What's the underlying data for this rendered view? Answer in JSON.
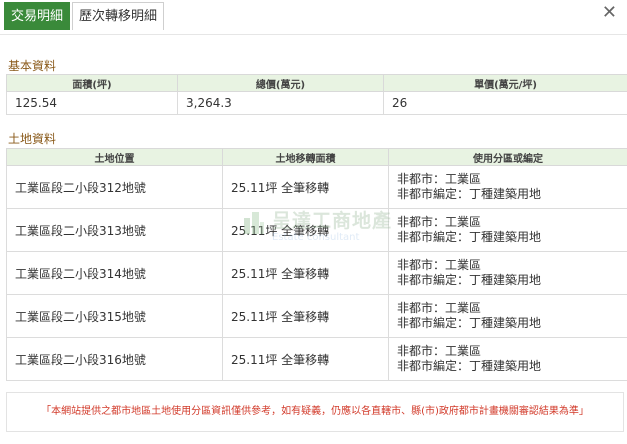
{
  "tabs": [
    {
      "label": "交易明細",
      "active": true
    },
    {
      "label": "歷次轉移明細",
      "active": false
    }
  ],
  "close_icon": "close-icon",
  "basic": {
    "title": "基本資料",
    "headers": [
      "面積(坪)",
      "總價(萬元)",
      "單價(萬元/坪)"
    ],
    "row": [
      "125.54",
      "3,264.3",
      "26"
    ]
  },
  "land": {
    "title": "土地資料",
    "headers": [
      "土地位置",
      "土地移轉面積",
      "使用分區或編定"
    ],
    "rows": [
      {
        "location": "工業區段二小段312地號",
        "area": "25.11坪 全筆移轉",
        "usage1": "非都市：工業區",
        "usage2": "非都市編定：丁種建築用地"
      },
      {
        "location": "工業區段二小段313地號",
        "area": "25.11坪 全筆移轉",
        "usage1": "非都市：工業區",
        "usage2": "非都市編定：丁種建築用地"
      },
      {
        "location": "工業區段二小段314地號",
        "area": "25.11坪 全筆移轉",
        "usage1": "非都市：工業區",
        "usage2": "非都市編定：丁種建築用地"
      },
      {
        "location": "工業區段二小段315地號",
        "area": "25.11坪 全筆移轉",
        "usage1": "非都市：工業區",
        "usage2": "非都市編定：丁種建築用地"
      },
      {
        "location": "工業區段二小段316地號",
        "area": "25.11坪 全筆移轉",
        "usage1": "非都市：工業區",
        "usage2": "非都市編定：丁種建築用地"
      }
    ]
  },
  "watermark": {
    "title": "呈達工商地產",
    "subtitle": "Estate consultant"
  },
  "note": "「本網站提供之都市地區土地使用分區資訊僅供參考，如有疑義，仍應以各直轄市、縣(市)政府都市計畫機關審認結果為準」",
  "colors": {
    "accent": "#3a8a3a",
    "header_bg": "#e8f3e2",
    "section_title": "#8a5a1a",
    "note_text": "#d23a2a"
  }
}
